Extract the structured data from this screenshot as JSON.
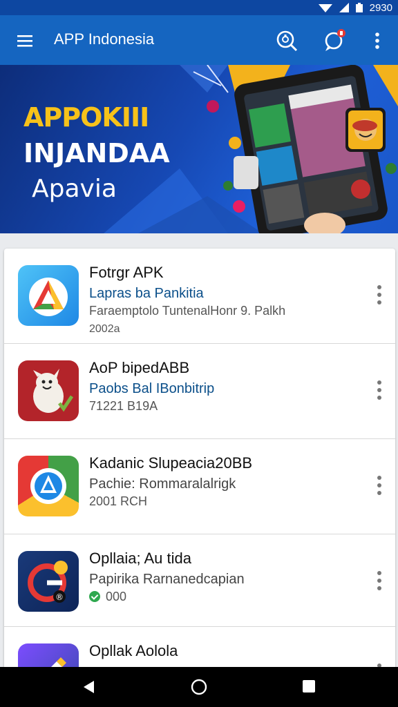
{
  "status_bar": {
    "time": "2930"
  },
  "app_bar": {
    "title": "APP Indonesia",
    "menu_icon": "menu-icon",
    "lens_icon": "lens-search-icon",
    "chat_icon": "chat-notification-icon",
    "more_icon": "more-vert-icon"
  },
  "banner": {
    "line1": "APPOKIII",
    "line2": "INJANDAA",
    "line3": "Apavia"
  },
  "apps": [
    {
      "name": "Fotrgr APK",
      "subtitle": "Lapras ba Pankitia",
      "meta": "Faraemptolo TuntenalHonr 9. Palkh",
      "meta2": "2002a",
      "icon": "triangle-logo-icon"
    },
    {
      "name": "AoP bipedABB",
      "subtitle": "Paobs Bal IBonbitrip",
      "meta": "71221 B19A",
      "icon": "dog-mascot-icon"
    },
    {
      "name": "Kadanic Slupeacia20BB",
      "subtitle": "Pachie: Rommaralalrigk",
      "meta": "2001 RCH",
      "icon": "triangle-logo-icon-2"
    },
    {
      "name": "Opllaia; Au tida",
      "subtitle": "Papirika Rarnanedcapian",
      "meta": "000",
      "icon": "g-logo-icon"
    },
    {
      "name": "Opllak Aolola",
      "subtitle": "",
      "meta": "",
      "icon": "edit-icon"
    }
  ],
  "nav_bar": {
    "back_icon": "back-icon",
    "home_icon": "home-icon",
    "recent_icon": "recent-apps-icon"
  },
  "colors": {
    "app_bar": "#1565c0",
    "status_bar": "#0d47a1",
    "banner_accent": "#f7c21a",
    "subtitle_blue": "#0b4f8a"
  }
}
